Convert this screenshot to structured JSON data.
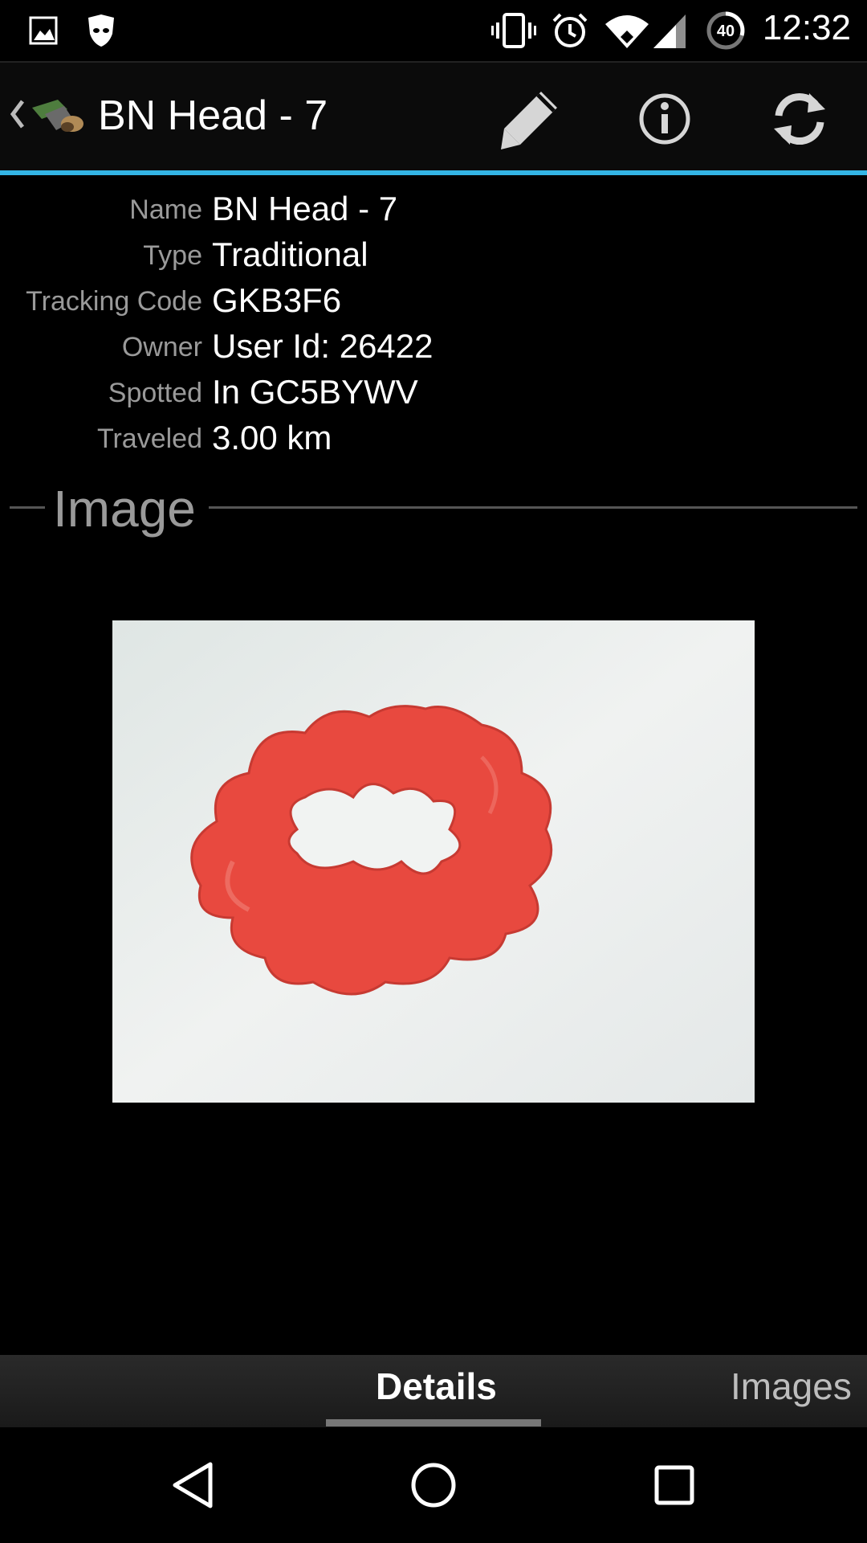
{
  "status_bar": {
    "time": "12:32",
    "battery_level": "40",
    "icons": [
      "image-icon",
      "cat-mask-icon",
      "vibrate-icon",
      "alarm-icon",
      "wifi-icon",
      "signal-icon",
      "battery-icon"
    ]
  },
  "action_bar": {
    "title": "BN Head - 7",
    "actions": [
      "edit-icon",
      "info-icon",
      "refresh-icon"
    ]
  },
  "details": [
    {
      "label": "Name",
      "value": "BN Head - 7"
    },
    {
      "label": "Type",
      "value": "Traditional"
    },
    {
      "label": "Tracking Code",
      "value": "GKB3F6"
    },
    {
      "label": "Owner",
      "value": "User Id: 26422"
    },
    {
      "label": "Spotted",
      "value": "In GC5BYWV"
    },
    {
      "label": "Traveled",
      "value": "3.00 km"
    }
  ],
  "section": {
    "title": "Image"
  },
  "tabs": {
    "details": "Details",
    "images": "Images",
    "active": "Details"
  },
  "colors": {
    "accent": "#33b5e5",
    "photo_object": "#e8493f",
    "photo_background": "#ecefef"
  }
}
